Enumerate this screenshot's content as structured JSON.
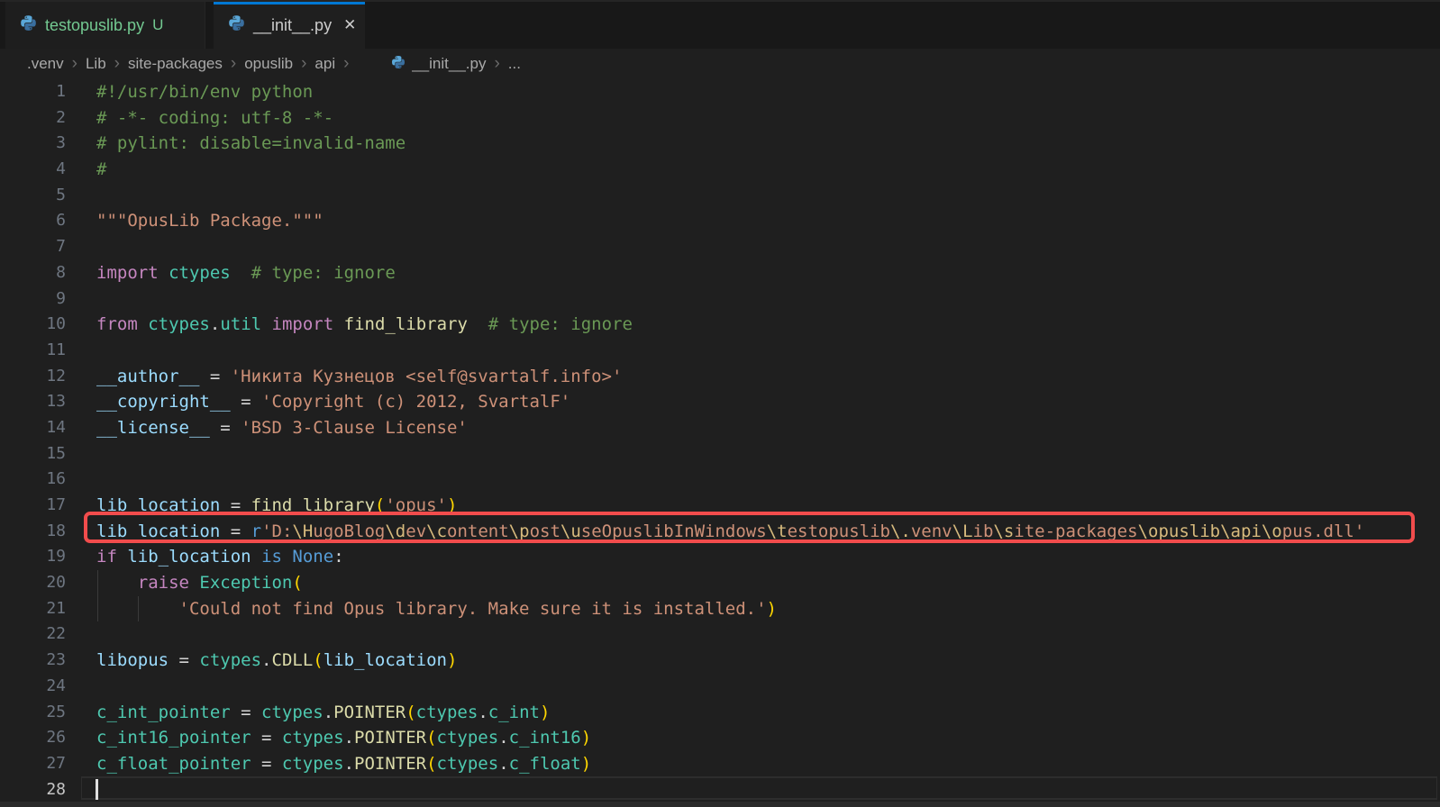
{
  "tabs": {
    "items": [
      {
        "label": "testopuslib.py",
        "badge": "U",
        "active": false
      },
      {
        "label": "__init__.py",
        "close_glyph": "✕",
        "active": true
      }
    ],
    "active_border_color": "#0078d4",
    "untracked_color": "#73c991"
  },
  "breadcrumb": {
    "separator": "›",
    "items": [
      ".venv",
      "Lib",
      "site-packages",
      "opuslib",
      "api"
    ],
    "file": "__init__.py",
    "more": "..."
  },
  "editor": {
    "cursor_line": 28,
    "annotation": {
      "shape": "red-rounded-rectangle",
      "line": 18,
      "color": "#f14c4c"
    },
    "token_colors": {
      "cm": "#6a9955",
      "str": "#ce9178",
      "esc": "#d7ba7d",
      "kw": "#c586c0",
      "kwb": "#569cd6",
      "cls": "#4ec9b0",
      "fn": "#dcdcaa",
      "var": "#9cdcfe",
      "op": "#d4d4d4",
      "br": "#ffd700"
    },
    "ui_colors": {
      "editor_bg": "#1f1f1f",
      "tabbar_bg": "#181818",
      "line_number": "#6e7681",
      "line_number_active": "#c6c6c6",
      "breadcrumb_fg": "#a9a9a9"
    },
    "lines": [
      {
        "n": 1,
        "segs": [
          [
            "cm",
            "#!/usr/bin/env python"
          ]
        ]
      },
      {
        "n": 2,
        "segs": [
          [
            "cm",
            "# -*- coding: utf-8 -*-"
          ]
        ]
      },
      {
        "n": 3,
        "segs": [
          [
            "cm",
            "# pylint: disable=invalid-name"
          ]
        ]
      },
      {
        "n": 4,
        "segs": [
          [
            "cm",
            "#"
          ]
        ]
      },
      {
        "n": 5,
        "segs": []
      },
      {
        "n": 6,
        "segs": [
          [
            "str",
            "\"\"\"OpusLib Package.\"\"\""
          ]
        ]
      },
      {
        "n": 7,
        "segs": []
      },
      {
        "n": 8,
        "segs": [
          [
            "kw",
            "import"
          ],
          [
            "op",
            " "
          ],
          [
            "cls",
            "ctypes"
          ],
          [
            "op",
            "  "
          ],
          [
            "cm",
            "# type: ignore"
          ]
        ]
      },
      {
        "n": 9,
        "segs": []
      },
      {
        "n": 10,
        "segs": [
          [
            "kw",
            "from"
          ],
          [
            "op",
            " "
          ],
          [
            "cls",
            "ctypes"
          ],
          [
            "op",
            "."
          ],
          [
            "cls",
            "util"
          ],
          [
            "op",
            " "
          ],
          [
            "kw",
            "import"
          ],
          [
            "op",
            " "
          ],
          [
            "fn",
            "find_library"
          ],
          [
            "op",
            "  "
          ],
          [
            "cm",
            "# type: ignore"
          ]
        ]
      },
      {
        "n": 11,
        "segs": []
      },
      {
        "n": 12,
        "segs": [
          [
            "var",
            "__author__"
          ],
          [
            "op",
            " = "
          ],
          [
            "str",
            "'Никита Кузнецов <self@svartalf.info>'"
          ]
        ]
      },
      {
        "n": 13,
        "segs": [
          [
            "var",
            "__copyright__"
          ],
          [
            "op",
            " = "
          ],
          [
            "str",
            "'Copyright (c) 2012, SvartalF'"
          ]
        ]
      },
      {
        "n": 14,
        "segs": [
          [
            "var",
            "__license__"
          ],
          [
            "op",
            " = "
          ],
          [
            "str",
            "'BSD 3-Clause License'"
          ]
        ]
      },
      {
        "n": 15,
        "segs": []
      },
      {
        "n": 16,
        "segs": []
      },
      {
        "n": 17,
        "segs": [
          [
            "var",
            "lib_location"
          ],
          [
            "op",
            " = "
          ],
          [
            "fn",
            "find_library"
          ],
          [
            "br",
            "("
          ],
          [
            "str",
            "'opus'"
          ],
          [
            "br",
            ")"
          ]
        ]
      },
      {
        "n": 18,
        "annotated": true,
        "segs": [
          [
            "var",
            "lib_location"
          ],
          [
            "op",
            " = "
          ],
          [
            "kwb",
            "r"
          ],
          [
            "str",
            "'D:"
          ],
          [
            "esc",
            "\\H"
          ],
          [
            "str",
            "ugoBlog"
          ],
          [
            "esc",
            "\\d"
          ],
          [
            "str",
            "ev"
          ],
          [
            "esc",
            "\\c"
          ],
          [
            "str",
            "ontent"
          ],
          [
            "esc",
            "\\p"
          ],
          [
            "str",
            "ost"
          ],
          [
            "esc",
            "\\u"
          ],
          [
            "str",
            "seOpuslibInWindows"
          ],
          [
            "esc",
            "\\t"
          ],
          [
            "str",
            "estopuslib"
          ],
          [
            "esc",
            "\\."
          ],
          [
            "str",
            "venv"
          ],
          [
            "esc",
            "\\L"
          ],
          [
            "str",
            "ib"
          ],
          [
            "esc",
            "\\s"
          ],
          [
            "str",
            "ite-packages"
          ],
          [
            "esc",
            "\\opuslib"
          ],
          [
            "esc",
            "\\api"
          ],
          [
            "esc",
            "\\o"
          ],
          [
            "str",
            "pus.dll'"
          ]
        ]
      },
      {
        "n": 19,
        "segs": [
          [
            "kw",
            "if"
          ],
          [
            "op",
            " "
          ],
          [
            "var",
            "lib_location"
          ],
          [
            "op",
            " "
          ],
          [
            "kwb",
            "is"
          ],
          [
            "op",
            " "
          ],
          [
            "kwb",
            "None"
          ],
          [
            "op",
            ":"
          ]
        ]
      },
      {
        "n": 20,
        "guides": [
          0
        ],
        "segs": [
          [
            "op",
            "    "
          ],
          [
            "kw",
            "raise"
          ],
          [
            "op",
            " "
          ],
          [
            "cls",
            "Exception"
          ],
          [
            "br",
            "("
          ]
        ]
      },
      {
        "n": 21,
        "guides": [
          0,
          4
        ],
        "segs": [
          [
            "op",
            "        "
          ],
          [
            "str",
            "'Could not find Opus library. Make sure it is installed.'"
          ],
          [
            "br",
            ")"
          ]
        ]
      },
      {
        "n": 22,
        "segs": []
      },
      {
        "n": 23,
        "segs": [
          [
            "var",
            "libopus"
          ],
          [
            "op",
            " = "
          ],
          [
            "cls",
            "ctypes"
          ],
          [
            "op",
            "."
          ],
          [
            "fn",
            "CDLL"
          ],
          [
            "br",
            "("
          ],
          [
            "var",
            "lib_location"
          ],
          [
            "br",
            ")"
          ]
        ]
      },
      {
        "n": 24,
        "segs": []
      },
      {
        "n": 25,
        "segs": [
          [
            "cls",
            "c_int_pointer"
          ],
          [
            "op",
            " = "
          ],
          [
            "cls",
            "ctypes"
          ],
          [
            "op",
            "."
          ],
          [
            "fn",
            "POINTER"
          ],
          [
            "br",
            "("
          ],
          [
            "cls",
            "ctypes"
          ],
          [
            "op",
            "."
          ],
          [
            "cls",
            "c_int"
          ],
          [
            "br",
            ")"
          ]
        ]
      },
      {
        "n": 26,
        "segs": [
          [
            "cls",
            "c_int16_pointer"
          ],
          [
            "op",
            " = "
          ],
          [
            "cls",
            "ctypes"
          ],
          [
            "op",
            "."
          ],
          [
            "fn",
            "POINTER"
          ],
          [
            "br",
            "("
          ],
          [
            "cls",
            "ctypes"
          ],
          [
            "op",
            "."
          ],
          [
            "cls",
            "c_int16"
          ],
          [
            "br",
            ")"
          ]
        ]
      },
      {
        "n": 27,
        "segs": [
          [
            "cls",
            "c_float_pointer"
          ],
          [
            "op",
            " = "
          ],
          [
            "cls",
            "ctypes"
          ],
          [
            "op",
            "."
          ],
          [
            "fn",
            "POINTER"
          ],
          [
            "br",
            "("
          ],
          [
            "cls",
            "ctypes"
          ],
          [
            "op",
            "."
          ],
          [
            "cls",
            "c_float"
          ],
          [
            "br",
            ")"
          ]
        ]
      },
      {
        "n": 28,
        "segs": []
      }
    ]
  }
}
